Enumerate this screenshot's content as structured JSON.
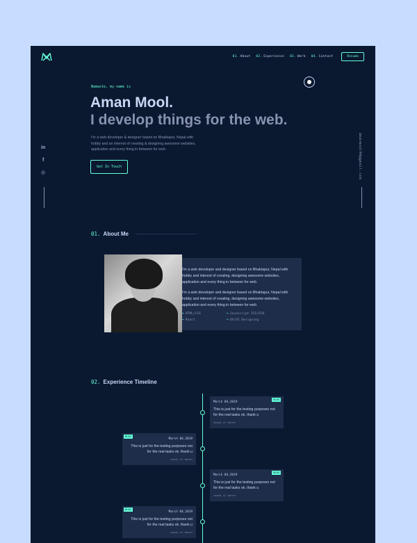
{
  "nav": {
    "items": [
      {
        "num": "01.",
        "label": "About"
      },
      {
        "num": "02.",
        "label": "Experience"
      },
      {
        "num": "03.",
        "label": "Work"
      },
      {
        "num": "04.",
        "label": "Contact"
      }
    ],
    "resume_label": "Resume"
  },
  "hero": {
    "greeting": "Namaste, my name is",
    "name": "Aman Mool.",
    "tagline": "I develop things for the web.",
    "description": "I'm a web developer & designer based on Bhaktapur, Nepal with hobby and an interest of creating & designing awesome websites, application and every thing in between for web.",
    "cta_label": "Get In Touch"
  },
  "socials": {
    "linkedin": "in",
    "facebook": "f",
    "instagram": "◎"
  },
  "email": "amanmool90@gmail.com",
  "about": {
    "num": "01.",
    "title": "About Me",
    "paragraph1": "I'm a web developer and designer based on Bhaktapur, Nepal with hobby and interest of creating, designing awesome websites, application and every thing in between for web.",
    "paragraph2": "I'm a web developer and designer based on Bhaktapur, Nepal with hobby and interest of creating, designing awesome websites, application and every thing in between for web.",
    "skills": [
      "HTML/CSS",
      "Javascript ES5/ES6",
      "React",
      "UX/UI Designing"
    ]
  },
  "experience": {
    "num": "02.",
    "title": "Experience Timeline",
    "entries": [
      {
        "date": "March 04,2019",
        "badge": "BLOG",
        "description": "This is just for the testing purposes not for the real tasks ok. thank u",
        "link": "check it here➜"
      },
      {
        "date": "March 04,2019",
        "badge": "BLOG",
        "description": "This is just for the testing purposes not for the real tasks ok. thank u",
        "link": "check it here➜"
      },
      {
        "date": "March 04,2019",
        "badge": "BLOG",
        "description": "This is just for the testing purposes not for the real tasks ok. thank u",
        "link": "check it here➜"
      },
      {
        "date": "March 04,2019",
        "badge": "BLOG",
        "description": "This is just for the testing purposes not for the real tasks ok. thank u",
        "link": "check it here➜"
      }
    ]
  },
  "colors": {
    "accent": "#64ffda",
    "background": "#0a192f",
    "card": "#1d2d4a",
    "page": "#c7dcff"
  }
}
